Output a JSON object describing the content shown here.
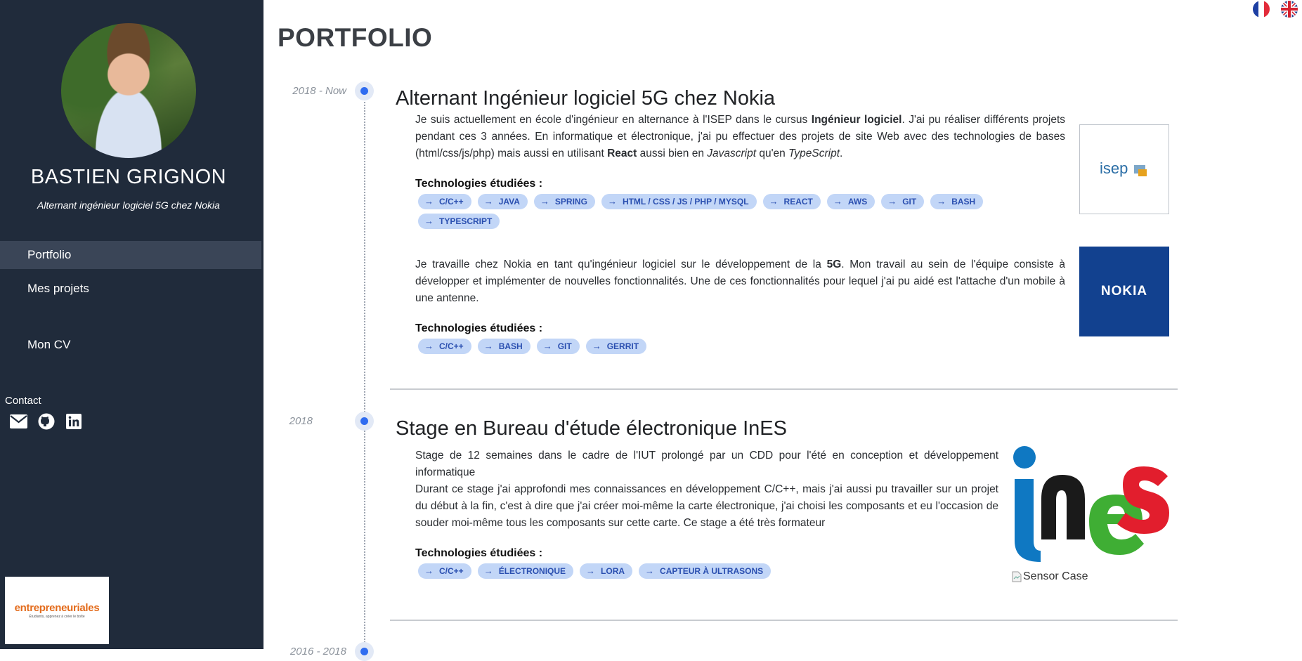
{
  "sidebar": {
    "name": "BASTIEN GRIGNON",
    "subtitle": "Alternant ingénieur logiciel 5G chez Nokia",
    "nav": [
      {
        "label": "Portfolio"
      },
      {
        "label": "Mes projets"
      },
      {
        "label": "Mon CV"
      }
    ],
    "contact_label": "Contact",
    "contact_icons": [
      "envelope-icon",
      "github-icon",
      "linkedin-icon"
    ],
    "sponsor": {
      "title": "entrepreneuriales",
      "tagline": "Étudiants, apprenez à créer le boîte"
    }
  },
  "languages": [
    "fr-flag-icon",
    "uk-flag-icon"
  ],
  "main": {
    "title": "PORTFOLIO",
    "entries": [
      {
        "date": "2018 - Now",
        "title": "Alternant Ingénieur logiciel 5G chez Nokia",
        "blocks": [
          {
            "p1": "Je suis actuellement en école d'ingénieur en alternance à l'ISEP dans le cursus ",
            "b1": "Ingénieur logiciel",
            "p2": ". J'ai pu réaliser différents projets pendant ces 3 années. En informatique et électronique, j'ai pu effectuer des projets de site Web avec des technologies de bases (html/css/js/php) mais aussi en utilisant ",
            "b2": "React",
            "p3": " aussi bien en ",
            "i1": "Javascript",
            "p4": " qu'en ",
            "i2": "TypeScript",
            "p5": ".",
            "tech_label": "Technologies étudiées :",
            "tags": [
              "C/C++",
              "JAVA",
              "SPRING",
              "HTML / CSS / JS / PHP / MYSQL",
              "REACT",
              "AWS",
              "GIT",
              "BASH",
              "TYPESCRIPT"
            ],
            "logo": "isep"
          },
          {
            "p1": "Je travaille chez Nokia en tant qu'ingénieur logiciel sur le développement de la ",
            "b1": "5G",
            "p2": ". Mon travail au sein de l'équipe consiste à développer et implémenter de nouvelles fonctionnalités. Une de ces fonctionnalités pour lequel j'ai pu aidé est l'attache d'un mobile à une antenne.",
            "tech_label": "Technologies étudiées :",
            "tags": [
              "C/C++",
              "BASH",
              "GIT",
              "GERRIT"
            ],
            "logo": "NOKIA"
          }
        ]
      },
      {
        "date": "2018",
        "title": "Stage en Bureau d'étude électronique InES",
        "p1": "Stage de 12 semaines dans le cadre de l'IUT prolongé par un CDD pour l'été en conception et développement informatique",
        "p2": "Durant ce stage j'ai approfondi mes connaissances en développement C/C++, mais j'ai aussi pu travailler sur un projet du début à la fin, c'est à dire que j'ai créer moi-même la carte électronique, j'ai choisi les composants et eu l'occasion de souder moi-même tous les composants sur cette carte. Ce stage a été très formateur",
        "tech_label": "Technologies étudiées :",
        "tags": [
          "C/C++",
          "ÉLECTRONIQUE",
          "LORA",
          "CAPTEUR À ULTRASONS"
        ],
        "logo_text": "ines",
        "broken_image_alt": "Sensor Case"
      },
      {
        "date": "2016 - 2018"
      }
    ]
  },
  "colors": {
    "sidebar_bg": "#202b3b",
    "accent": "#2f6cf0",
    "tag_bg": "#c2d6f7",
    "tag_text": "#2a4fb0",
    "nokia_blue": "#12418f"
  }
}
